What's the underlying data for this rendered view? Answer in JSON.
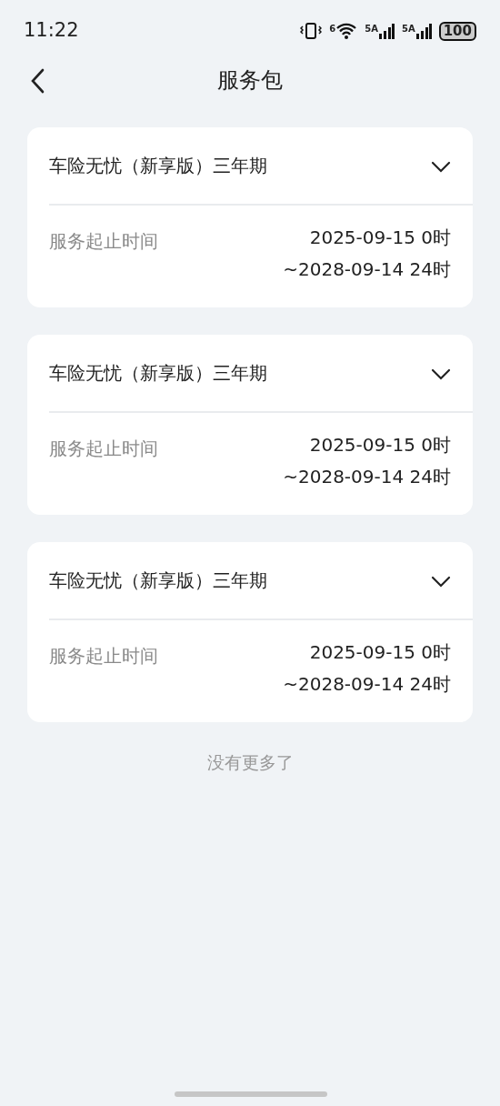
{
  "status_bar": {
    "time": "11:22",
    "wifi_badge": "6",
    "sim_1": "5A",
    "sim_2": "5A",
    "battery": "100"
  },
  "header": {
    "title": "服务包"
  },
  "packages": [
    {
      "name": "车险无忧（新享版）三年期",
      "expanded": true,
      "period_label": "服务起止时间",
      "start": "2025-09-15 0时",
      "end": "~2028-09-14 24时"
    },
    {
      "name": "车险无忧（新享版）三年期",
      "expanded": true,
      "period_label": "服务起止时间",
      "start": "2025-09-15 0时",
      "end": "~2028-09-14 24时"
    },
    {
      "name": "车险无忧（新享版）三年期",
      "expanded": true,
      "period_label": "服务起止时间",
      "start": "2025-09-15 0时",
      "end": "~2028-09-14 24时"
    }
  ],
  "footer_note": "没有更多了"
}
